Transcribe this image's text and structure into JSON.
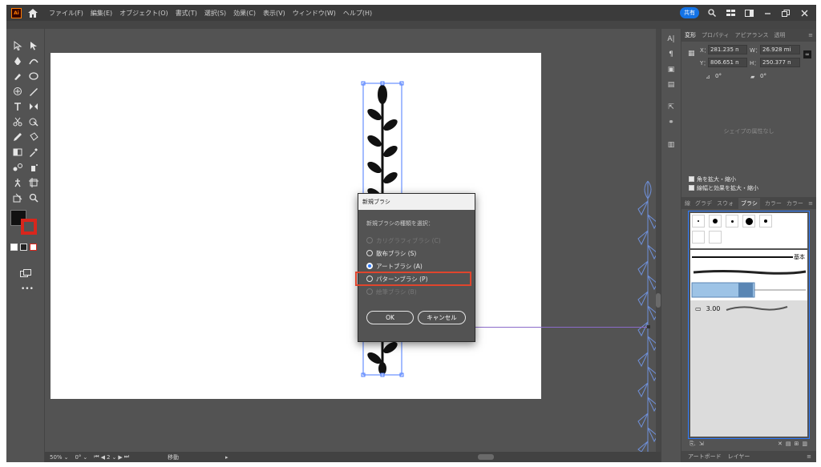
{
  "app": {
    "logo": "Ai",
    "menu": [
      "ファイル(F)",
      "編集(E)",
      "オブジェクト(O)",
      "書式(T)",
      "選択(S)",
      "効果(C)",
      "表示(V)",
      "ウィンドウ(W)",
      "ヘルプ(H)"
    ],
    "share_label": "共有"
  },
  "dialog": {
    "title": "新規ブラシ",
    "prompt": "新規ブラシの種類を選択：",
    "options": [
      {
        "label": "カリグラフィブラシ (C)",
        "enabled": false,
        "checked": false
      },
      {
        "label": "散布ブラシ (S)",
        "enabled": true,
        "checked": false
      },
      {
        "label": "アートブラシ (A)",
        "enabled": true,
        "checked": true
      },
      {
        "label": "パターンブラシ (P)",
        "enabled": true,
        "checked": false
      },
      {
        "label": "絵筆ブラシ (B)",
        "enabled": false,
        "checked": false
      }
    ],
    "ok_label": "OK",
    "cancel_label": "キャンセル"
  },
  "transform_panel": {
    "tabs": [
      "変形",
      "プロパティ",
      "アピアランス",
      "透明"
    ],
    "x_label": "X：",
    "x_value": "281.235 n",
    "y_label": "Y：",
    "y_value": "806.651 n",
    "w_label": "W：",
    "w_value": "26.928 mi",
    "h_label": "H：",
    "h_value": "250.377 n",
    "angle_value": "0°",
    "shear_value": "0°",
    "shape_empty": "シェイプの属性なし",
    "scale_corners": "角を拡大・縮小",
    "scale_strokes": "線幅と効果を拡大・縮小"
  },
  "brush_panel": {
    "tabs": [
      "線",
      "グラデ",
      "スウォ",
      "ブラシ",
      "カラー",
      "カラー"
    ],
    "active_tab": "ブラシ",
    "basic_label": "基本",
    "size_value": "3.00"
  },
  "bottom_tabs": [
    "アートボード",
    "レイヤー"
  ],
  "statusbar": {
    "zoom": "50%",
    "rotation": "0°",
    "artboard": "2",
    "tool": "移動"
  },
  "colors": {
    "fill": "#111111",
    "stroke": "#d9261c",
    "selection": "#4a7aff",
    "highlight": "#e0452d"
  }
}
